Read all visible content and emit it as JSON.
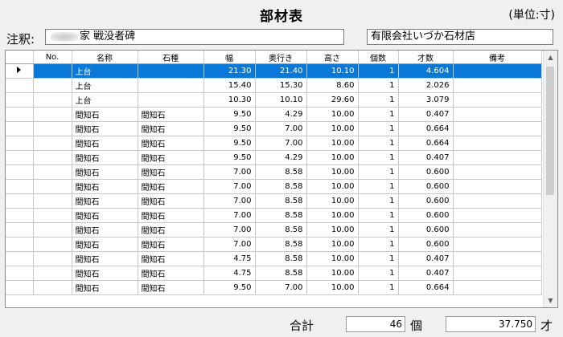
{
  "window": {
    "title": "部材表",
    "unit_label": "(単位:寸)"
  },
  "header": {
    "note_label": "注釈:",
    "note_value": "家  戦没者碑",
    "company": "有限会社いづか石材店"
  },
  "table": {
    "columns": [
      "No.",
      "名称",
      "石種",
      "幅",
      "奥行き",
      "高さ",
      "個数",
      "才数",
      "備考"
    ],
    "rows": [
      {
        "no": "",
        "name": "上台",
        "stone": "",
        "width": "21.30",
        "depth": "21.40",
        "height": "10.10",
        "qty": "1",
        "volume": "4.604",
        "note": ""
      },
      {
        "no": "",
        "name": "上台",
        "stone": "",
        "width": "15.40",
        "depth": "15.30",
        "height": "8.60",
        "qty": "1",
        "volume": "2.026",
        "note": ""
      },
      {
        "no": "",
        "name": "上台",
        "stone": "",
        "width": "10.30",
        "depth": "10.10",
        "height": "29.60",
        "qty": "1",
        "volume": "3.079",
        "note": ""
      },
      {
        "no": "",
        "name": "間知石",
        "stone": "間知石",
        "width": "9.50",
        "depth": "4.29",
        "height": "10.00",
        "qty": "1",
        "volume": "0.407",
        "note": ""
      },
      {
        "no": "",
        "name": "間知石",
        "stone": "間知石",
        "width": "9.50",
        "depth": "7.00",
        "height": "10.00",
        "qty": "1",
        "volume": "0.664",
        "note": ""
      },
      {
        "no": "",
        "name": "間知石",
        "stone": "間知石",
        "width": "9.50",
        "depth": "7.00",
        "height": "10.00",
        "qty": "1",
        "volume": "0.664",
        "note": ""
      },
      {
        "no": "",
        "name": "間知石",
        "stone": "間知石",
        "width": "9.50",
        "depth": "4.29",
        "height": "10.00",
        "qty": "1",
        "volume": "0.407",
        "note": ""
      },
      {
        "no": "",
        "name": "間知石",
        "stone": "間知石",
        "width": "7.00",
        "depth": "8.58",
        "height": "10.00",
        "qty": "1",
        "volume": "0.600",
        "note": ""
      },
      {
        "no": "",
        "name": "間知石",
        "stone": "間知石",
        "width": "7.00",
        "depth": "8.58",
        "height": "10.00",
        "qty": "1",
        "volume": "0.600",
        "note": ""
      },
      {
        "no": "",
        "name": "間知石",
        "stone": "間知石",
        "width": "7.00",
        "depth": "8.58",
        "height": "10.00",
        "qty": "1",
        "volume": "0.600",
        "note": ""
      },
      {
        "no": "",
        "name": "間知石",
        "stone": "間知石",
        "width": "7.00",
        "depth": "8.58",
        "height": "10.00",
        "qty": "1",
        "volume": "0.600",
        "note": ""
      },
      {
        "no": "",
        "name": "間知石",
        "stone": "間知石",
        "width": "7.00",
        "depth": "8.58",
        "height": "10.00",
        "qty": "1",
        "volume": "0.600",
        "note": ""
      },
      {
        "no": "",
        "name": "間知石",
        "stone": "間知石",
        "width": "7.00",
        "depth": "8.58",
        "height": "10.00",
        "qty": "1",
        "volume": "0.600",
        "note": ""
      },
      {
        "no": "",
        "name": "間知石",
        "stone": "間知石",
        "width": "4.75",
        "depth": "8.58",
        "height": "10.00",
        "qty": "1",
        "volume": "0.407",
        "note": ""
      },
      {
        "no": "",
        "name": "間知石",
        "stone": "間知石",
        "width": "4.75",
        "depth": "8.58",
        "height": "10.00",
        "qty": "1",
        "volume": "0.407",
        "note": ""
      },
      {
        "no": "",
        "name": "間知石",
        "stone": "間知石",
        "width": "9.50",
        "depth": "7.00",
        "height": "10.00",
        "qty": "1",
        "volume": "0.664",
        "note": ""
      }
    ],
    "selected_row": 0
  },
  "footer": {
    "total_label": "合計",
    "count_value": "46",
    "count_unit": "個",
    "volume_value": "37.750",
    "volume_unit": "才"
  },
  "colors": {
    "selection": "#0a78d7",
    "window_bg": "#f0f0f0"
  },
  "icons": {
    "row_indicator": "triangle-right-icon",
    "scroll_up": "chevron-up-icon",
    "scroll_down": "chevron-down-icon"
  }
}
